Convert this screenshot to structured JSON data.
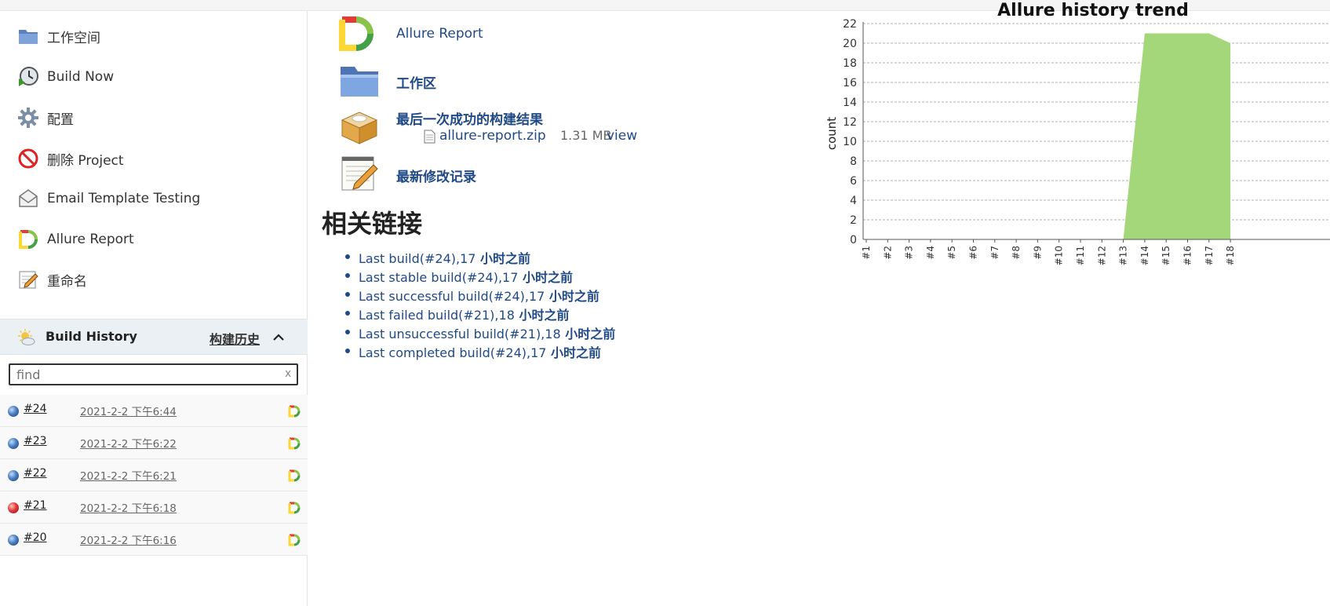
{
  "sidebar": {
    "tasks": [
      {
        "label": "工作空间",
        "icon": "folder-icon"
      },
      {
        "label": "Build Now",
        "icon": "clock-play-icon"
      },
      {
        "label": "配置",
        "icon": "gear-icon"
      },
      {
        "label": "删除 Project",
        "icon": "no-entry-icon"
      },
      {
        "label": "Email Template Testing",
        "icon": "envelope-icon"
      },
      {
        "label": "Allure Report",
        "icon": "allure-logo-icon"
      },
      {
        "label": "重命名",
        "icon": "notepad-icon"
      }
    ]
  },
  "build_history": {
    "title": "Build History",
    "trend_label": "构建历史",
    "search_placeholder": "find",
    "clear_label": "x",
    "builds": [
      {
        "number": "#24",
        "date": "2021-2-2 下午6:44",
        "status": "blue"
      },
      {
        "number": "#23",
        "date": "2021-2-2 下午6:22",
        "status": "blue"
      },
      {
        "number": "#22",
        "date": "2021-2-2 下午6:21",
        "status": "blue"
      },
      {
        "number": "#21",
        "date": "2021-2-2 下午6:18",
        "status": "red"
      },
      {
        "number": "#20",
        "date": "2021-2-2 下午6:16",
        "status": "blue"
      }
    ]
  },
  "main": {
    "items": {
      "allure": "Allure Report",
      "workspace": "工作区",
      "last_success": "最后一次成功的构建结果",
      "changes": "最新修改记录"
    },
    "artifact": {
      "name": "allure-report.zip",
      "size": "1.31 MB",
      "view": "view"
    },
    "related": {
      "title": "相关链接",
      "links": [
        {
          "text": "Last build(#24),17",
          "ago": " 小时之前"
        },
        {
          "text": "Last stable build(#24),17",
          "ago": " 小时之前"
        },
        {
          "text": "Last successful build(#24),17",
          "ago": " 小时之前"
        },
        {
          "text": "Last failed build(#21),18",
          "ago": " 小时之前"
        },
        {
          "text": "Last unsuccessful build(#21),18",
          "ago": " 小时之前"
        },
        {
          "text": "Last completed build(#24),17",
          "ago": " 小时之前"
        }
      ]
    }
  },
  "chart_data": {
    "type": "area",
    "title": "Allure history trend",
    "ylabel": "count",
    "xlabel": "",
    "ylim": [
      0,
      22
    ],
    "yticks": [
      0,
      2,
      4,
      6,
      8,
      10,
      12,
      14,
      16,
      18,
      20,
      22
    ],
    "x": [
      "#1",
      "#2",
      "#3",
      "#4",
      "#5",
      "#6",
      "#7",
      "#8",
      "#9",
      "#10",
      "#11",
      "#12",
      "#13",
      "#14",
      "#15",
      "#16",
      "#17",
      "#18"
    ],
    "series": [
      {
        "values": [
          0,
          0,
          0,
          0,
          0,
          0,
          0,
          0,
          0,
          0,
          0,
          0,
          0,
          21,
          21,
          21,
          21,
          20
        ],
        "color": "#a3d77a"
      }
    ],
    "grid": true
  }
}
